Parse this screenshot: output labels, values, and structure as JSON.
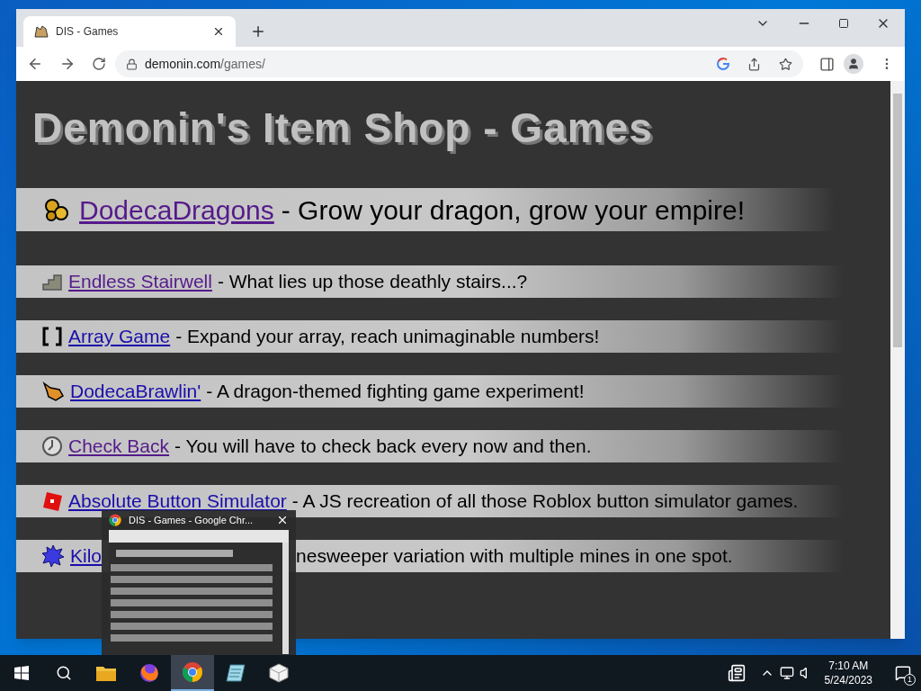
{
  "browser": {
    "tab": {
      "title": "DIS - Games",
      "selected": true
    },
    "url_domain": "demonin.com",
    "url_path": "/games/"
  },
  "page": {
    "heading": "Demonin's Item Shop - Games",
    "games": [
      {
        "kind": "featured",
        "link": "DodecaDragons",
        "visited": true,
        "description": "- Grow your dragon, grow your empire!"
      },
      {
        "kind": "regular",
        "link": "Endless Stairwell",
        "visited": true,
        "description": "- What lies up those deathly stairs...?"
      },
      {
        "kind": "regular",
        "link": "Array Game",
        "visited": false,
        "description": "- Expand your array, reach unimaginable numbers!"
      },
      {
        "kind": "regular",
        "link": "DodecaBrawlin'",
        "visited": false,
        "description": "- A dragon-themed fighting game experiment!"
      },
      {
        "kind": "regular",
        "link": "Check Back",
        "visited": true,
        "description": "- You will have to check back every now and then."
      },
      {
        "kind": "regular",
        "link": "Absolute Button Simulator",
        "visited": false,
        "description": "- A JS recreation of all those Roblox button simulator games."
      },
      {
        "kind": "covered",
        "link": "Kilo",
        "visited": false,
        "description": "nesweeper variation with multiple mines in one spot."
      }
    ]
  },
  "thumbnail_popup": {
    "title": "DIS - Games - Google Chr..."
  },
  "taskbar": {
    "apps": [
      {
        "selected": false
      },
      {
        "selected": false
      },
      {
        "selected": true
      },
      {
        "selected": false
      },
      {
        "selected": false
      }
    ],
    "time": "7:10 AM",
    "date": "5/24/2023",
    "notifications": "1"
  }
}
